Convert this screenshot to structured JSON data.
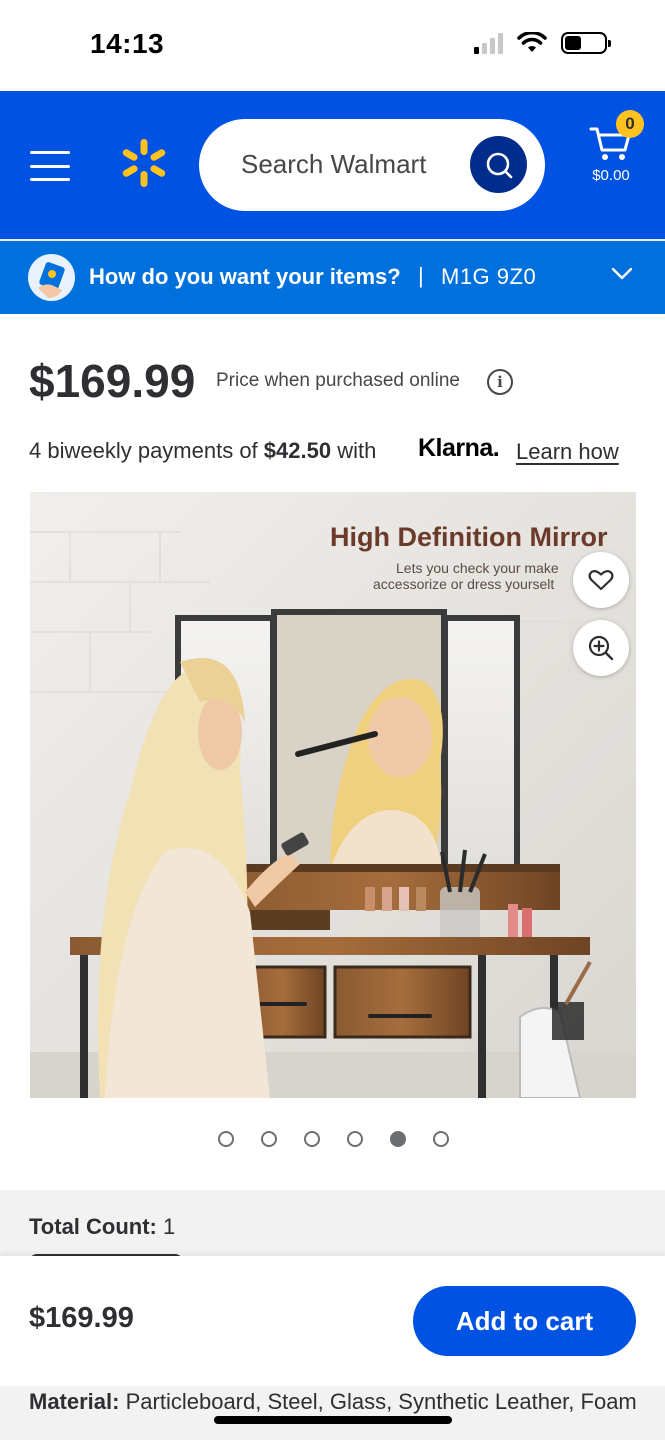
{
  "status_bar": {
    "time": "14:13"
  },
  "header": {
    "search_placeholder": "Search Walmart",
    "cart_count": "0",
    "cart_total": "$0.00",
    "brand_color": "#0053e2",
    "spark_color": "#ffc220"
  },
  "delivery": {
    "prompt": "How do you want your items?",
    "separator": "|",
    "postal_code": "M1G 9Z0"
  },
  "pricing": {
    "price": "$169.99",
    "price_note": "Price when purchased online",
    "klarna_prefix": "4 biweekly payments of",
    "klarna_amount": "$42.50",
    "klarna_with": "with",
    "klarna_brand": "Klarna.",
    "learn_how": "Learn how"
  },
  "product_image": {
    "heading": "High Definition Mirror",
    "sub_line1": "Lets you check your make",
    "sub_line2": "accessorize or dress yourselt",
    "dot_count": 6,
    "active_dot": 5
  },
  "details": {
    "total_count_label": "Total Count:",
    "total_count_value": "1",
    "material_label": "Material:",
    "material_value": "Particleboard, Steel, Glass, Synthetic Leather, Foam"
  },
  "sticky": {
    "price": "$169.99",
    "add_to_cart": "Add to cart"
  }
}
